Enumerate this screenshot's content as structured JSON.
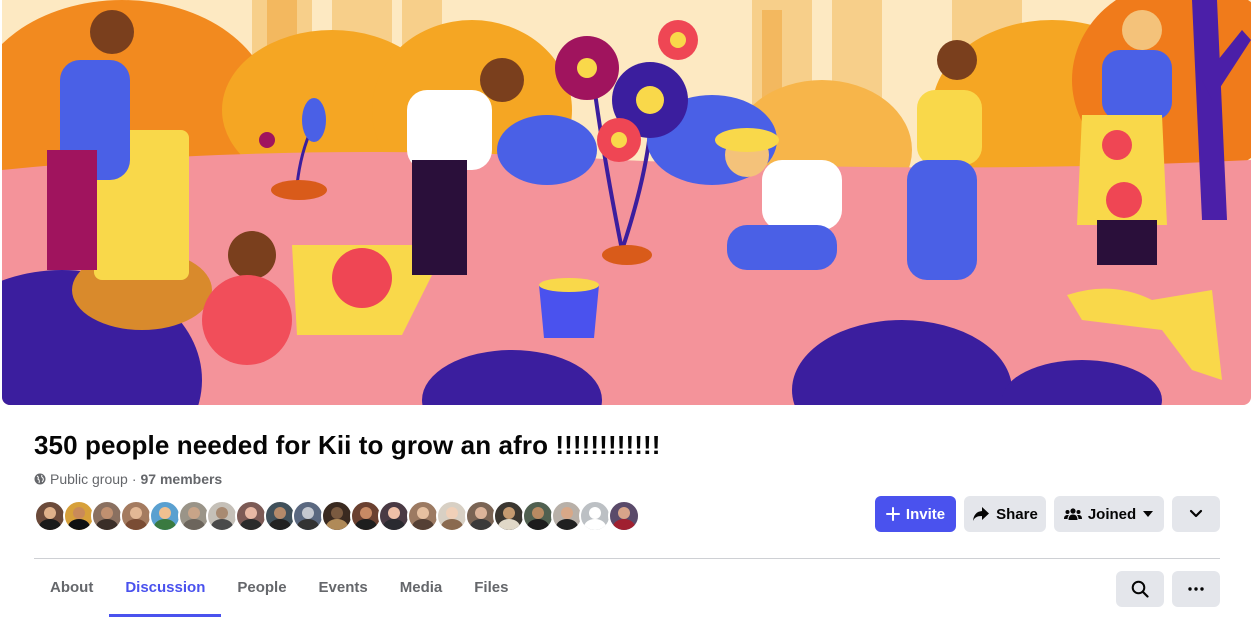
{
  "group": {
    "title": "350 people needed for Kii to grow an afro !!!!!!!!!!!!",
    "privacy": "Public group",
    "separator": "·",
    "members": "97 members"
  },
  "actions": {
    "invite_label": "Invite",
    "share_label": "Share",
    "joined_label": "Joined"
  },
  "tabs": [
    {
      "label": "About"
    },
    {
      "label": "Discussion",
      "active": true
    },
    {
      "label": "People"
    },
    {
      "label": "Events"
    },
    {
      "label": "Media"
    },
    {
      "label": "Files"
    }
  ],
  "colors": {
    "accent": "#4a52ee",
    "button_gray": "#e4e6eb",
    "secondary_text": "#65676b"
  },
  "icons": [
    "globe-icon",
    "plus-icon",
    "share-arrow-icon",
    "group-people-icon",
    "caret-down-icon",
    "chevron-down-icon",
    "search-icon",
    "ellipsis-icon"
  ]
}
